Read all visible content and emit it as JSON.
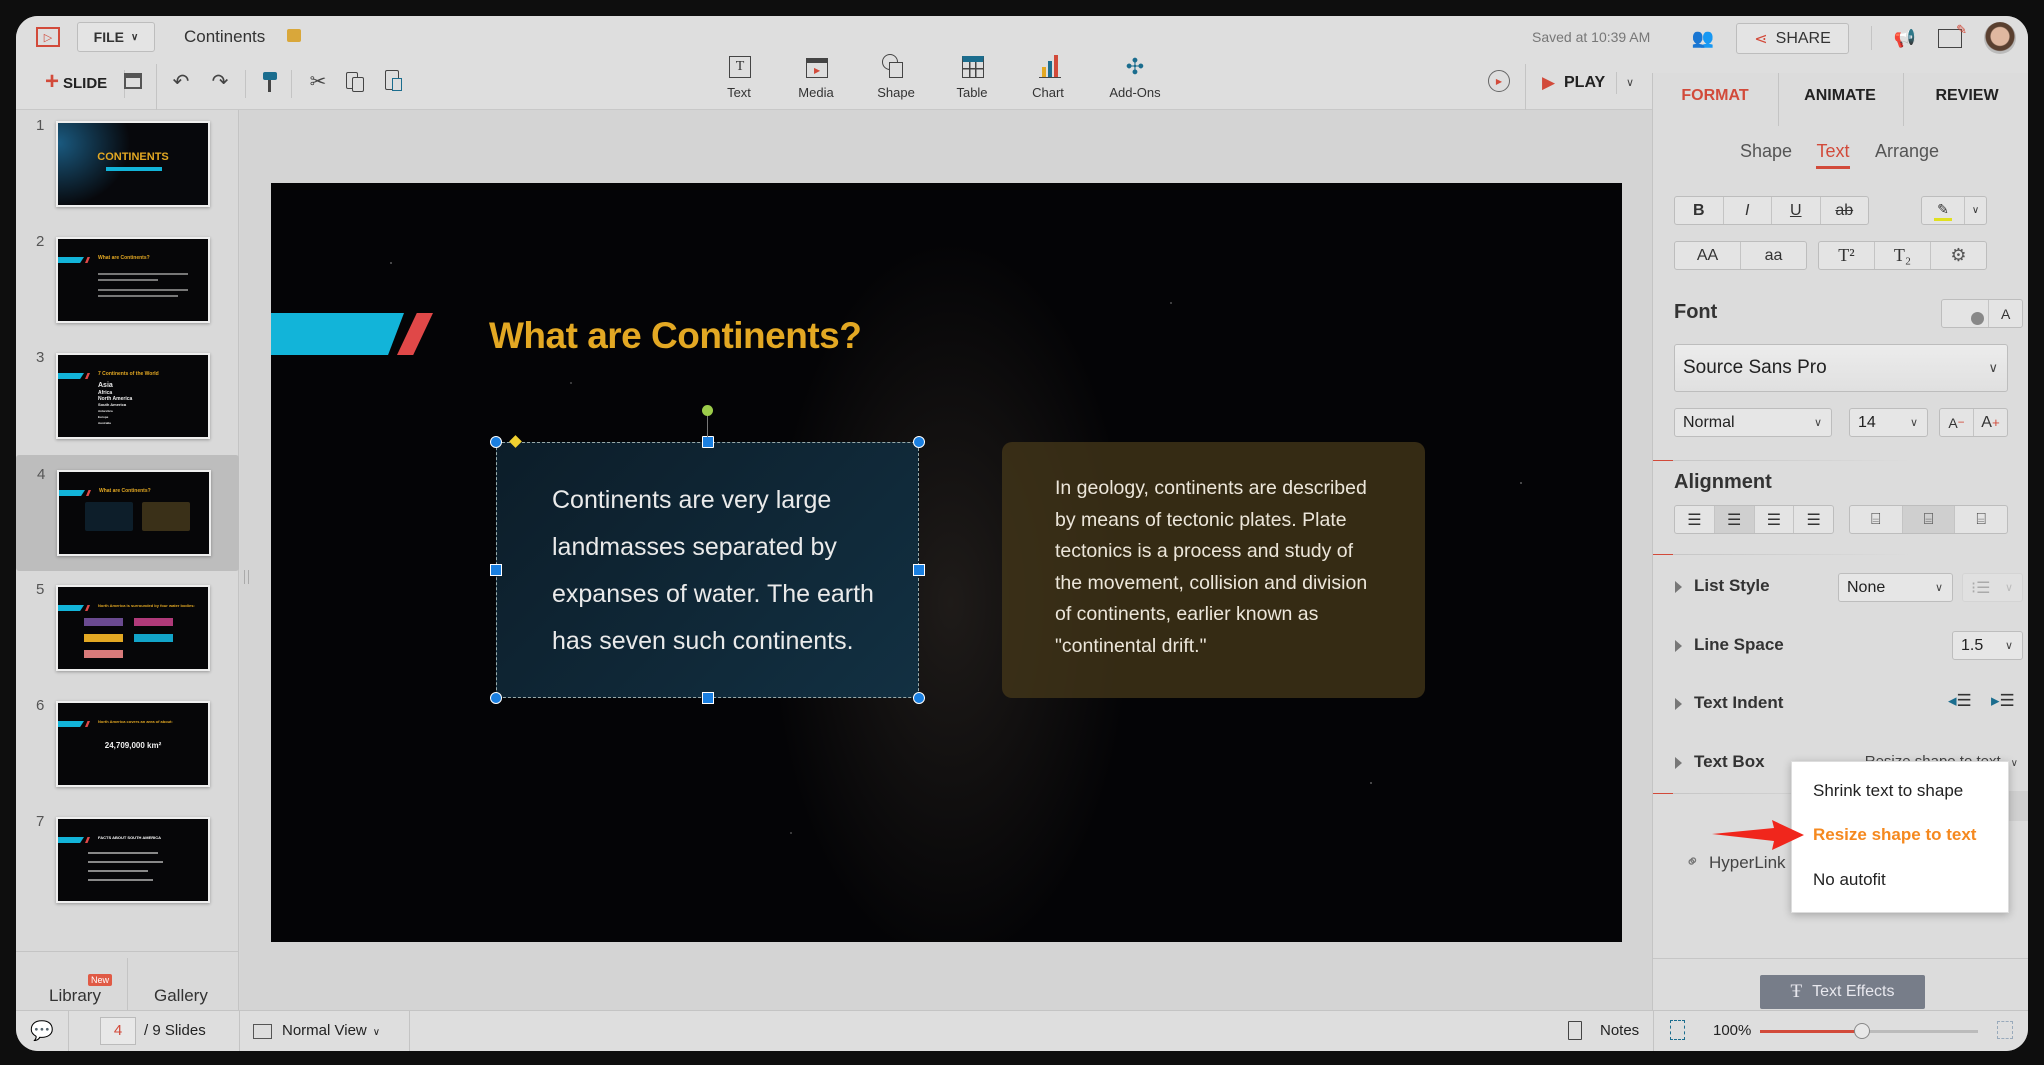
{
  "header": {
    "file_label": "FILE",
    "doc_title": "Continents",
    "saved_status": "Saved at 10:39 AM",
    "share_label": "SHARE"
  },
  "toolbar": {
    "slide_label": "SLIDE",
    "insert": [
      {
        "label": "Text"
      },
      {
        "label": "Media"
      },
      {
        "label": "Shape"
      },
      {
        "label": "Table"
      },
      {
        "label": "Chart"
      },
      {
        "label": "Add-Ons"
      }
    ],
    "play_label": "PLAY"
  },
  "thumbnails": [
    {
      "num": "1",
      "title": "CONTINENTS"
    },
    {
      "num": "2",
      "title": "What are Continents?"
    },
    {
      "num": "3",
      "title": "7 Continents of the World",
      "items": [
        "Asia",
        "Africa",
        "North America",
        "South America",
        "Antarctica",
        "Europe",
        "Australia"
      ]
    },
    {
      "num": "4",
      "title": "What are Continents?"
    },
    {
      "num": "5",
      "title": "North America is surrounded by four water bodies:"
    },
    {
      "num": "6",
      "title": "North America covers an area of about:",
      "figure": "24,709,000 km²"
    },
    {
      "num": "7",
      "title": "FACTS ABOUT SOUTH AMERICA"
    }
  ],
  "left_bottom": {
    "library": "Library",
    "new_badge": "New",
    "gallery": "Gallery"
  },
  "slide": {
    "title": "What are Continents?",
    "box1": "Continents are very large landmasses separated by expanses of water. The earth has seven such continents.",
    "box2": "In geology, continents are described by means of tectonic plates. Plate tectonics is a process and study of the movement, collision and division of continents, earlier known as \"continental drift.\""
  },
  "panel": {
    "tabs": [
      "FORMAT",
      "ANIMATE",
      "REVIEW"
    ],
    "subtabs": [
      "Shape",
      "Text",
      "Arrange"
    ],
    "style_buttons": [
      "B",
      "I",
      "U",
      "ab"
    ],
    "case_buttons": [
      "AA",
      "aa",
      "T²",
      "T₂"
    ],
    "font_label": "Font",
    "font_family": "Source Sans Pro",
    "font_style": "Normal",
    "font_size": "14",
    "alignment_label": "Alignment",
    "list_style_label": "List Style",
    "list_style_value": "None",
    "line_space_label": "Line Space",
    "line_space_value": "1.5",
    "text_indent_label": "Text Indent",
    "text_box_label": "Text Box",
    "text_box_value": "Resize shape to text",
    "hyperlink_label": "HyperLink",
    "text_effects_label": "Text Effects",
    "dropdown": [
      "Shrink text to shape",
      "Resize shape to text",
      "No autofit"
    ]
  },
  "status": {
    "current_page": "4",
    "total": "/ 9 Slides",
    "view": "Normal View",
    "notes": "Notes",
    "zoom": "100%",
    "zoom_fraction": 0.47
  },
  "colors": {
    "accent": "#d24a3a",
    "title_gold": "#e3a823",
    "highlight_orange": "#f5891f",
    "selection": "#1a7fe0"
  }
}
